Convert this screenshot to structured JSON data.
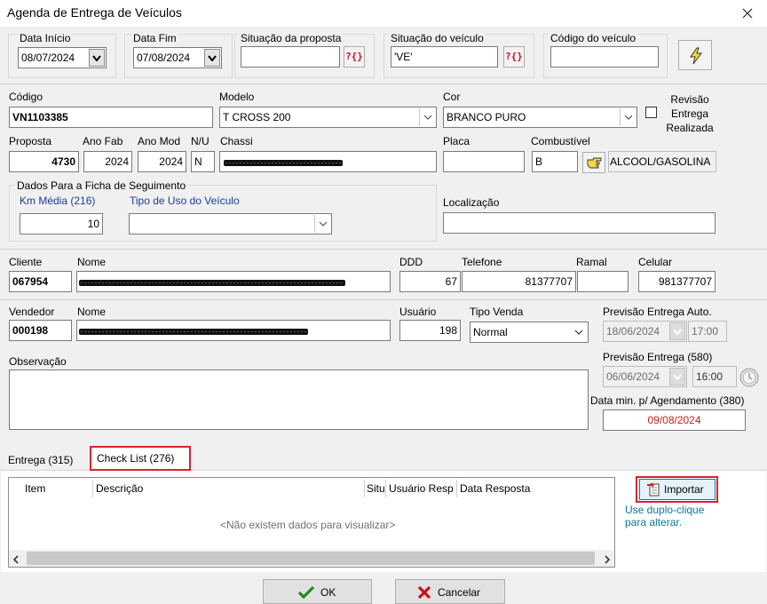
{
  "window": {
    "title": "Agenda de Entrega de Veículos"
  },
  "filters": {
    "data_inicio_label": "Data Início",
    "data_inicio": "08/07/2024",
    "data_fim_label": "Data Fim",
    "data_fim": "07/08/2024",
    "situacao_proposta_label": "Situação da proposta",
    "situacao_proposta": "",
    "situacao_veiculo_label": "Situação do veículo",
    "situacao_veiculo": "'VE'",
    "codigo_veiculo_label": "Código do veículo",
    "codigo_veiculo": "",
    "lookup_glyph": "?{}"
  },
  "vehicle": {
    "codigo_label": "Código",
    "codigo": "VN1103385",
    "modelo_label": "Modelo",
    "modelo": "T CROSS 200",
    "cor_label": "Cor",
    "cor": "BRANCO PURO",
    "revisao_label": "Revisão Entrega Realizada",
    "revisao_checked": false,
    "proposta_label": "Proposta",
    "proposta": "4730",
    "ano_fab_label": "Ano Fab",
    "ano_fab": "2024",
    "ano_mod_label": "Ano Mod",
    "ano_mod": "2024",
    "nu_label": "N/U",
    "nu": "N",
    "chassi_label": "Chassi",
    "placa_label": "Placa",
    "placa": "",
    "combustivel_label": "Combustível",
    "combustivel": "B",
    "combustivel_desc": "ALCOOL/GASOLINA",
    "localizacao_label": "Localização",
    "localizacao": ""
  },
  "ficha": {
    "title": "Dados Para a Ficha de Seguimento",
    "km_media_label": "Km Média (216)",
    "km_media": "10",
    "tipo_uso_label": "Tipo de Uso do Veículo",
    "tipo_uso": ""
  },
  "cliente": {
    "cliente_label": "Cliente",
    "cliente": "067954",
    "nome_label": "Nome",
    "ddd_label": "DDD",
    "ddd": "67",
    "telefone_label": "Telefone",
    "telefone": "81377707",
    "ramal_label": "Ramal",
    "ramal": "",
    "celular_label": "Celular",
    "celular": "981377707"
  },
  "vendedor": {
    "vendedor_label": "Vendedor",
    "vendedor": "000198",
    "nome_label": "Nome",
    "usuario_label": "Usuário",
    "usuario": "198",
    "tipo_venda_label": "Tipo Venda",
    "tipo_venda": "Normal",
    "prev_auto_label": "Previsão Entrega Auto.",
    "prev_auto_date": "18/06/2024",
    "prev_auto_time": "17:00"
  },
  "observacao": {
    "label": "Observação",
    "value": ""
  },
  "previsao": {
    "label": "Previsão Entrega (580)",
    "date": "06/06/2024",
    "time": "16:00",
    "data_min_label": "Data min. p/ Agendamento (380)",
    "data_min": "09/08/2024"
  },
  "tabs": [
    {
      "label": "Entrega (315)"
    },
    {
      "label": "Check List (276)"
    }
  ],
  "grid": {
    "columns": [
      "Item",
      "Descrição",
      "Situ",
      "Usuário Resp",
      "Data Resposta"
    ],
    "empty_text": "<Não existem dados para visualizar>"
  },
  "side": {
    "importar_label": "Importar",
    "hint": "Use duplo-clique para alterar."
  },
  "footer": {
    "ok_label": "OK",
    "cancelar_label": "Cancelar"
  },
  "colors": {
    "highlight": "#e0202a",
    "label_blue": "#1a3a9c",
    "hint": "#0a7a9a",
    "date_red": "#d01c1c"
  }
}
